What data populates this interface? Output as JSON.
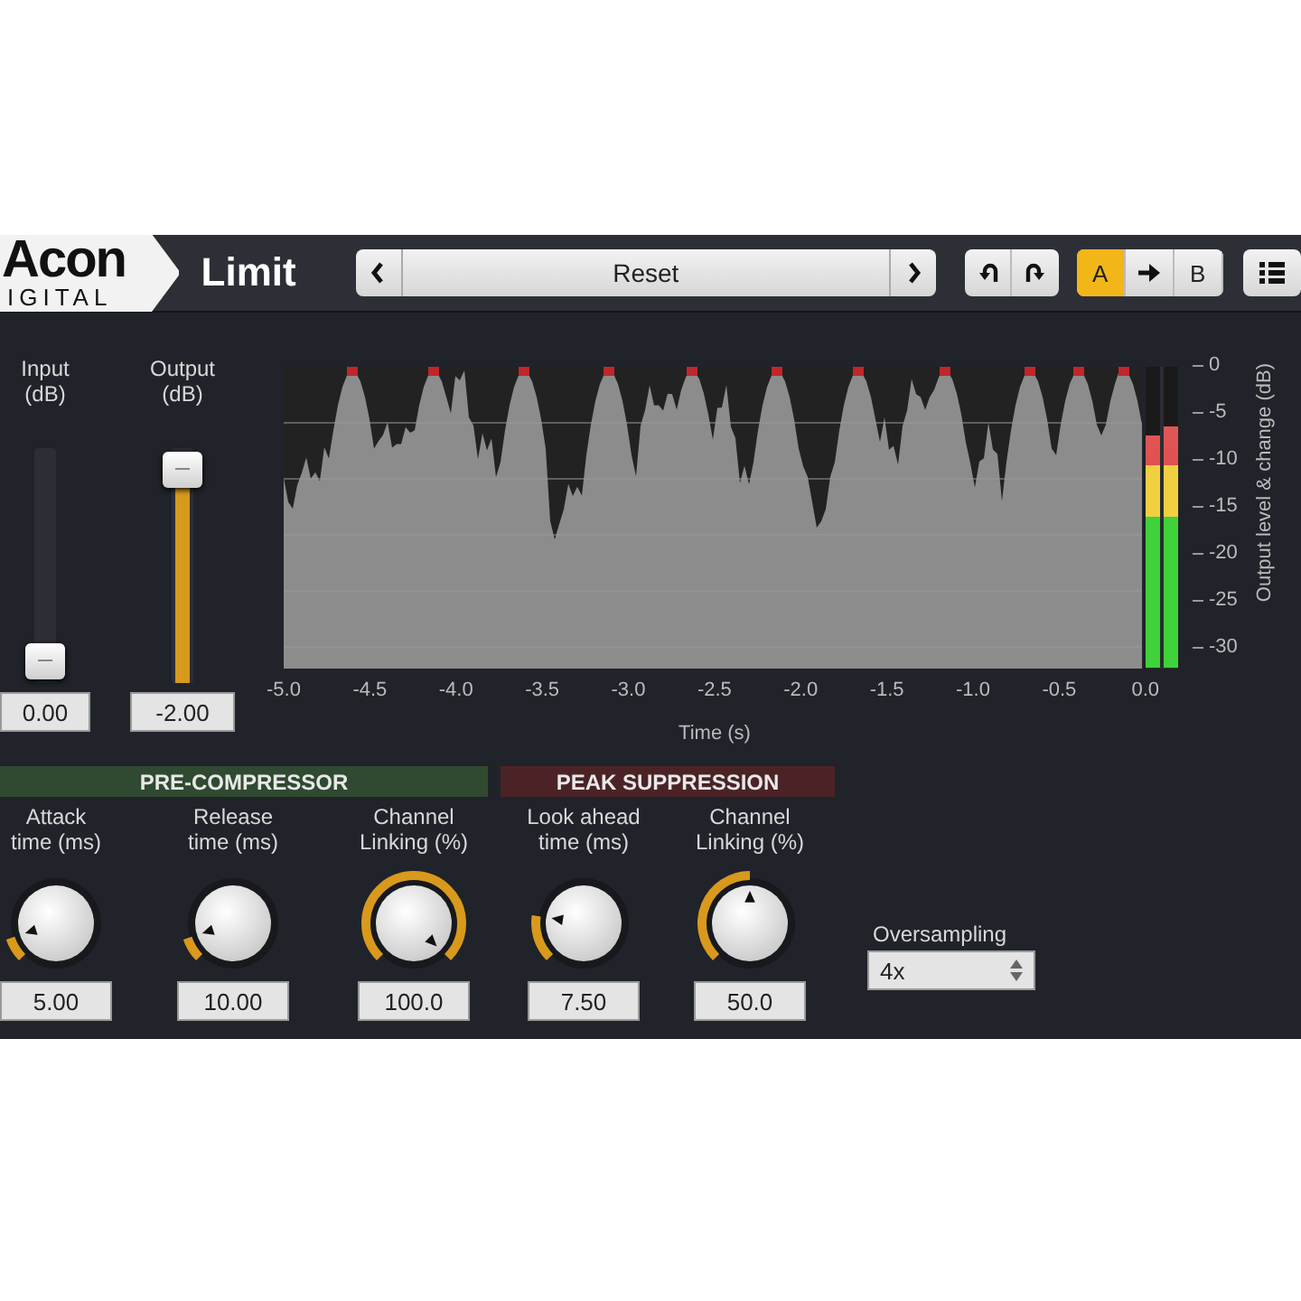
{
  "header": {
    "logo": {
      "word": "Acon",
      "subword": "IGITAL"
    },
    "title": "Limit",
    "preset": "Reset",
    "ab": [
      {
        "label": "A",
        "selected": true
      },
      {
        "label": "B",
        "selected": false
      }
    ]
  },
  "faders": [
    {
      "label": "Input\n(dB)",
      "value": "0.00",
      "level": 0.02,
      "filled": false
    },
    {
      "label": "Output\n(dB)",
      "value": "-2.00",
      "level": 0.98,
      "filled": true
    }
  ],
  "graph": {
    "x_ticks": [
      "-5.0",
      "-4.5",
      "-4.0",
      "-3.5",
      "-3.0",
      "-2.5",
      "-2.0",
      "-1.5",
      "-1.0",
      "-0.5",
      "0.0"
    ],
    "x_label": "Time (s)",
    "y_ticks": [
      "0",
      "-5",
      "-10",
      "-15",
      "-20",
      "-25",
      "-30"
    ],
    "y_label": "Output level & change (dB)",
    "meters": [
      {
        "level": 0.77
      },
      {
        "level": 0.8
      }
    ]
  },
  "sections": [
    {
      "title": "PRE-COMPRESSOR",
      "color": "#2f4a30",
      "knobs": [
        {
          "label": "Attack\ntime (ms)",
          "value": "5.00"
        },
        {
          "label": "Release\ntime (ms)",
          "value": "10.00"
        },
        {
          "label": "Channel\nLinking (%)",
          "value": "100.0"
        }
      ]
    },
    {
      "title": "PEAK SUPPRESSION",
      "color": "#4b2326",
      "knobs": [
        {
          "label": "Look ahead\ntime (ms)",
          "value": "7.50"
        },
        {
          "label": "Channel\nLinking (%)",
          "value": "50.0"
        }
      ]
    }
  ],
  "oversampling": {
    "label": "Oversampling",
    "value": "4x"
  }
}
